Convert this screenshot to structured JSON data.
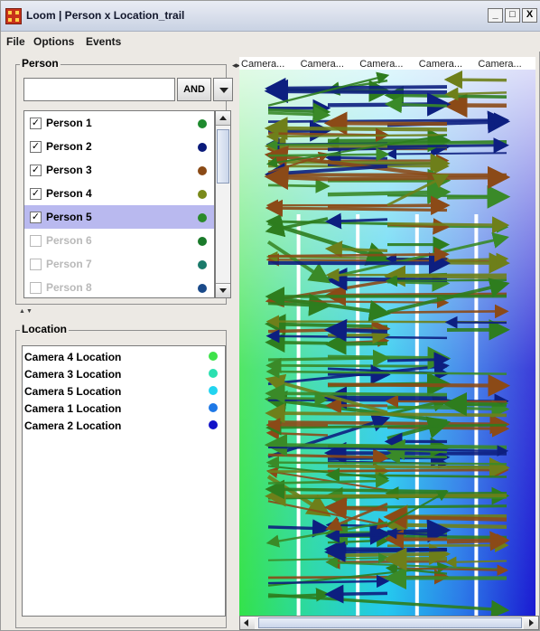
{
  "window": {
    "title": "Loom | Person x Location_trail",
    "minimize": "_",
    "maximize": "□",
    "close": "X"
  },
  "menu": [
    "File",
    "Options",
    "Events"
  ],
  "person_panel": {
    "title": "Person",
    "search_value": "",
    "operator": "AND",
    "people": [
      {
        "label": "Person 1",
        "checked": true,
        "enabled": true,
        "selected": false,
        "color": "#1e8a2e"
      },
      {
        "label": "Person 2",
        "checked": true,
        "enabled": true,
        "selected": false,
        "color": "#0a1a7a"
      },
      {
        "label": "Person 3",
        "checked": true,
        "enabled": true,
        "selected": false,
        "color": "#8a4a16"
      },
      {
        "label": "Person 4",
        "checked": true,
        "enabled": true,
        "selected": false,
        "color": "#7a8a1a"
      },
      {
        "label": "Person 5",
        "checked": true,
        "enabled": true,
        "selected": true,
        "color": "#2a8a2a"
      },
      {
        "label": "Person 6",
        "checked": false,
        "enabled": false,
        "selected": false,
        "color": "#1a7a2a"
      },
      {
        "label": "Person 7",
        "checked": false,
        "enabled": false,
        "selected": false,
        "color": "#1a7a6a"
      },
      {
        "label": "Person 8",
        "checked": false,
        "enabled": false,
        "selected": false,
        "color": "#1a4a8a"
      }
    ]
  },
  "location_panel": {
    "title": "Location",
    "locations": [
      {
        "label": "Camera 4 Location",
        "color": "#3ee24a"
      },
      {
        "label": "Camera 3 Location",
        "color": "#2ae0b0"
      },
      {
        "label": "Camera 5 Location",
        "color": "#22d4f0"
      },
      {
        "label": "Camera 1 Location",
        "color": "#1e78e6"
      },
      {
        "label": "Camera 2 Location",
        "color": "#1212c8"
      }
    ]
  },
  "chart_data": {
    "type": "trail",
    "column_labels": [
      "Camera...",
      "Camera...",
      "Camera...",
      "Camera...",
      "Camera..."
    ],
    "column_colors": [
      "#33e24a",
      "#2ad8a8",
      "#22c8ee",
      "#2a7ae8",
      "#1a1ad2"
    ],
    "series": [
      {
        "name": "Person 1",
        "color": "#2e7d1e"
      },
      {
        "name": "Person 2",
        "color": "#0d1f80"
      },
      {
        "name": "Person 3",
        "color": "#8b4a17"
      },
      {
        "name": "Person 4",
        "color": "#6e7f1a"
      },
      {
        "name": "Person 5",
        "color": "#3a8a28"
      }
    ]
  }
}
